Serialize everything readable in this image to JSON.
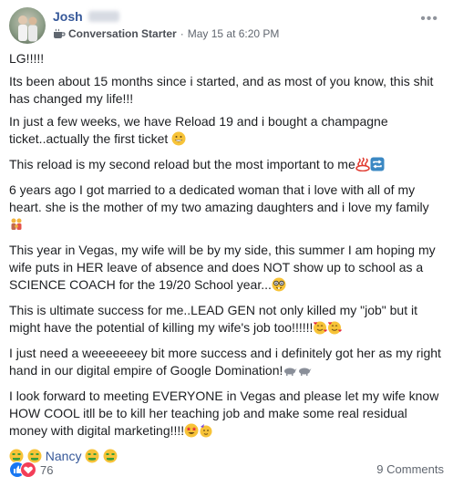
{
  "post": {
    "author": "Josh",
    "badge": "Conversation Starter",
    "timestamp": "May 15 at 6:20 PM",
    "more_label": "•••",
    "paragraphs": [
      "LG!!!!!",
      "Its been about 15 months since i started, and as most of you know, this shit has changed my life!!!",
      "In just a few weeks, we have Reload 19 and i bought a champagne ticket..actually the first ticket",
      "This reload is my second reload but the most important to me",
      "6 years ago I got married to a dedicated woman that i love with all of my heart. she is the mother of my two amazing daughters and i love my family",
      "This year in Vegas, my wife will be by my side, this summer I am hoping my wife puts in HER leave of absence and does NOT show up to school as a SCIENCE COACH for the 19/20 School year...",
      "This is ultimate success for me..LEAD GEN not only killed my \"job\" but it might have the potential of killing my wife's job too!!!!!!",
      "I just need a weeeeeeey bit more success and i definitely got her as my right hand in our digital empire of Google Domination!",
      "I look forward to meeting EVERYONE in Vegas and please let my wife know HOW COOL itll be to kill her teaching job and make some real residual money with digital marketing!!!!"
    ],
    "mention": "Nancy",
    "reaction_count": "76",
    "comments": "9 Comments"
  }
}
